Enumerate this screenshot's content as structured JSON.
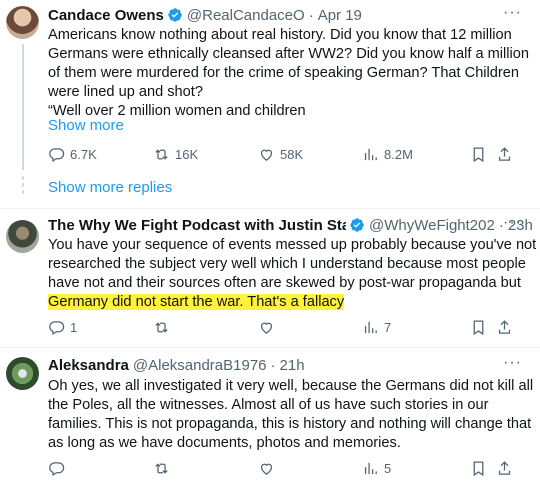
{
  "tweets": [
    {
      "name": "Candace Owens",
      "verified": true,
      "handle": "@RealCandaceO",
      "time": "Apr 19",
      "more_icon": "···",
      "lines": [
        "Americans know nothing about real history. Did you know that 12 million",
        "Germans were ethnically cleansed after WW2? Did you know half a million",
        "of them were murdered for the crime of speaking German? That Children",
        "were lined up and shot?",
        "“Well over 2 million women and children"
      ],
      "show_more": "Show more",
      "stats": {
        "replies": "6.7K",
        "reposts": "16K",
        "likes": "58K",
        "views": "8.2M"
      }
    },
    {
      "name": "The Why We Fight Podcast with Justin Star",
      "verified": true,
      "handle": "@WhyWeFight202",
      "time": "23h",
      "more_icon": "···",
      "lines": [
        "You have your sequence of events messed up probably because you've not",
        "researched the subject very well which I understand because most people",
        "have not and their sources often are skewed by post-war propaganda but",
        "Germany did not start the war. That's a fallacy"
      ],
      "highlight_color": "#fff23a",
      "stats": {
        "replies": "1",
        "reposts": "",
        "likes": "",
        "views": "7"
      }
    },
    {
      "name": "Aleksandra",
      "verified": false,
      "handle": "@AleksandraB1976",
      "time": "21h",
      "more_icon": "···",
      "lines": [
        "Oh yes, we all investigated it very well, because the Germans did not kill all",
        "the Poles, all the witnesses. Almost all of us have such stories in our",
        "families. This is not propaganda, this is history and nothing will change that",
        "as long as we have documents, photos and memories."
      ],
      "stats": {
        "replies": "",
        "reposts": "",
        "likes": "",
        "views": "5"
      }
    }
  ],
  "show_more_replies": "Show more replies",
  "colors": {
    "accent": "#1d9bf0",
    "muted": "#536471",
    "text": "#0f1419",
    "divider": "#eff3f4"
  }
}
